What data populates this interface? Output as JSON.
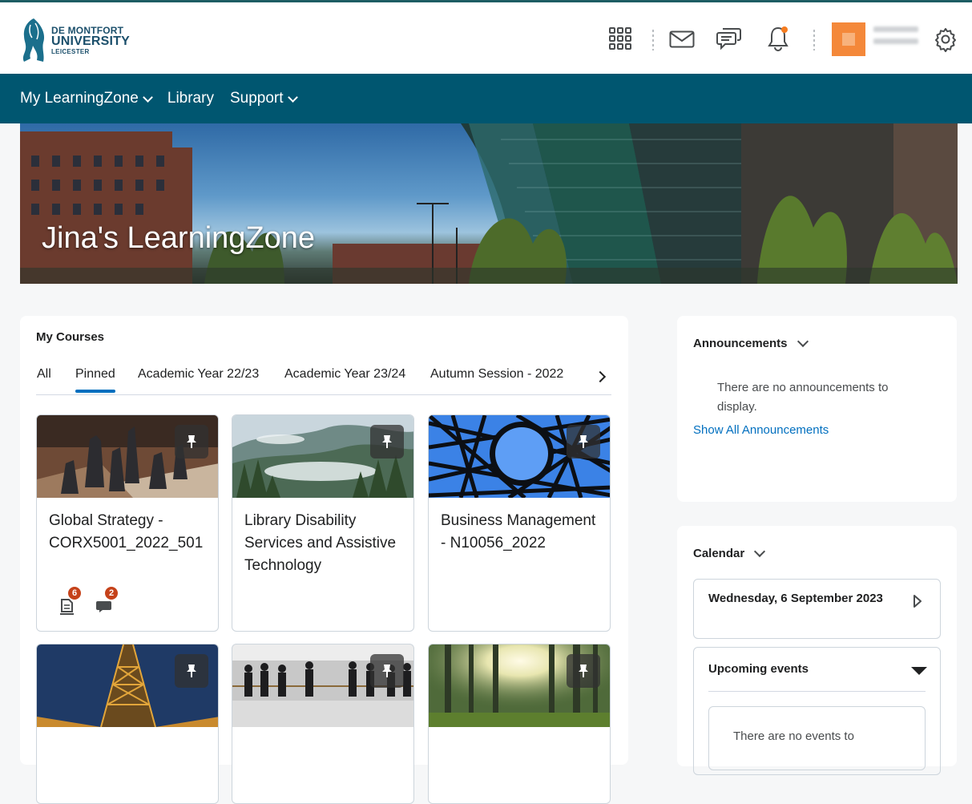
{
  "header": {
    "logo": {
      "line1": "DE MONTFORT",
      "line2": "UNIVERSITY",
      "line3": "LEICESTER"
    },
    "icons": [
      "apps-grid-icon",
      "mail-icon",
      "chat-icon",
      "bell-icon",
      "gear-icon"
    ],
    "accent_color": "#005670",
    "notification_color": "#f57c20"
  },
  "nav": {
    "items": [
      {
        "label": "My LearningZone",
        "has_dropdown": true
      },
      {
        "label": "Library",
        "has_dropdown": false
      },
      {
        "label": "Support",
        "has_dropdown": true
      }
    ]
  },
  "banner": {
    "title": "Jina's LearningZone"
  },
  "courses": {
    "heading": "My Courses",
    "tabs": [
      "All",
      "Pinned",
      "Academic Year 22/23",
      "Academic Year 23/24",
      "Autumn Session - 2022"
    ],
    "active_tab": "Pinned",
    "tiles": [
      {
        "title": "Global Strategy - CORX5001_2022_501",
        "pinned": true,
        "assignments_badge": "6",
        "discussions_badge": "2"
      },
      {
        "title": "Library Disability Services and Assistive Technology",
        "pinned": true
      },
      {
        "title": "Business Management - N10056_2022",
        "pinned": true
      },
      {
        "title": "",
        "pinned": true
      },
      {
        "title": "",
        "pinned": true
      },
      {
        "title": "",
        "pinned": true
      }
    ]
  },
  "announcements": {
    "title": "Announcements",
    "empty_text": "There are no announcements to display.",
    "link": "Show All Announcements"
  },
  "calendar": {
    "title": "Calendar",
    "date": "Wednesday, 6 September 2023",
    "upcoming_title": "Upcoming events",
    "upcoming_empty": "There are no events to"
  }
}
